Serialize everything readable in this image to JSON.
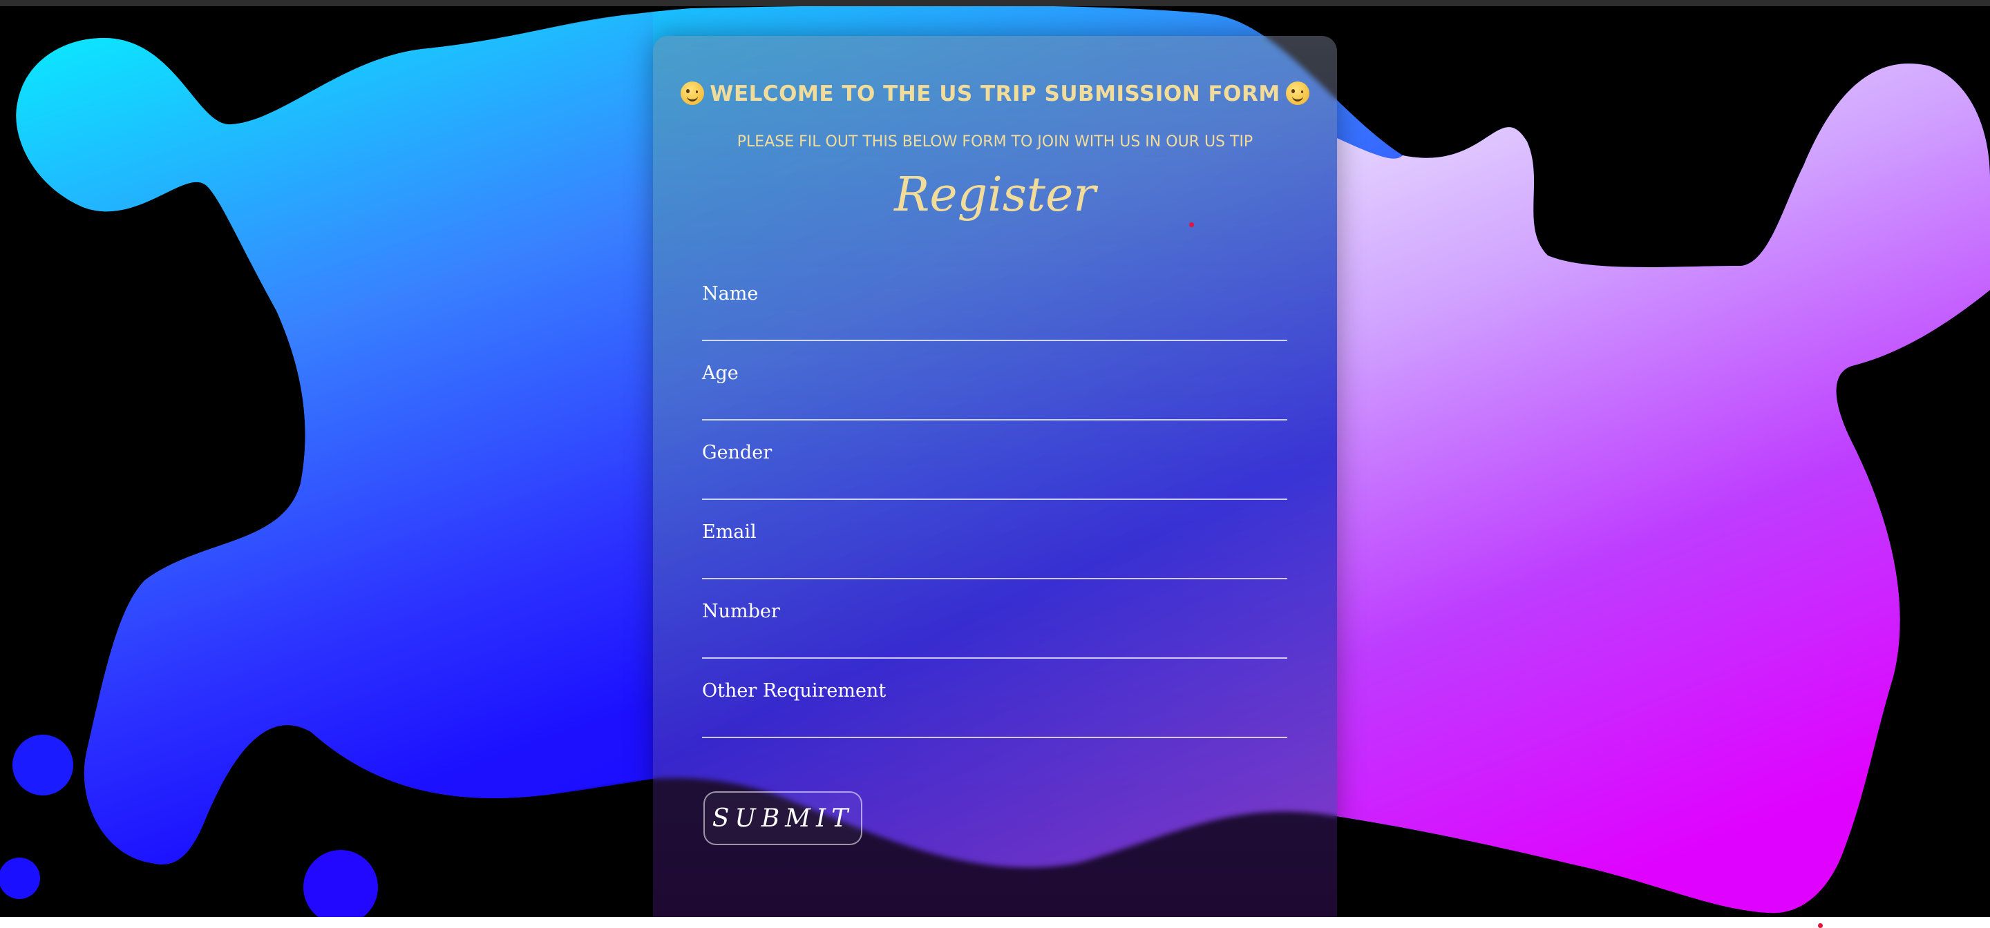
{
  "form": {
    "heading": "WELCOME TO THE US TRIP SUBMISSION FORM",
    "heading_icon": "winking-face-icon",
    "subheading": "PLEASE FIL OUT THIS BELOW FORM TO JOIN WITH US IN OUR US TIP",
    "title": "Register",
    "fields": [
      {
        "label": "Name",
        "value": ""
      },
      {
        "label": "Age",
        "value": ""
      },
      {
        "label": "Gender",
        "value": ""
      },
      {
        "label": "Email",
        "value": ""
      },
      {
        "label": "Number",
        "value": ""
      },
      {
        "label": "Other Requirement",
        "value": ""
      }
    ],
    "submit_label": "SUBMIT"
  },
  "colors": {
    "accent_text": "#f2dc9a",
    "background": "#000000",
    "blob_gradient_start": "#00f0ff",
    "blob_gradient_mid": "#2020ff",
    "blob_gradient_end": "#e000ff"
  }
}
